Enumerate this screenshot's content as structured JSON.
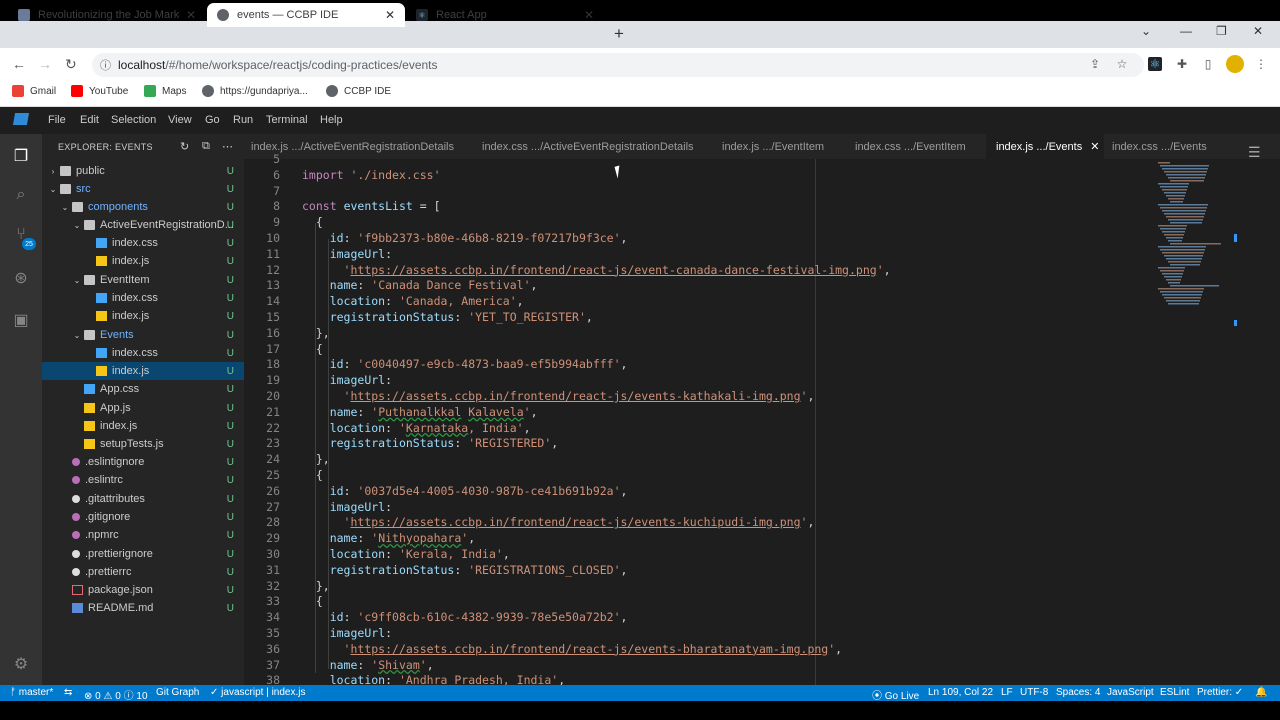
{
  "browser": {
    "tabs": [
      {
        "title": "Revolutionizing the Job Market |"
      },
      {
        "title": "events — CCBP IDE"
      },
      {
        "title": "React App"
      }
    ],
    "url_host": "localhost",
    "url_path": "/#/home/workspace/reactjs/coding-practices/events",
    "bookmarks": [
      "Gmail",
      "YouTube",
      "Maps",
      "https://gundapriya...",
      "CCBP IDE"
    ]
  },
  "menu": [
    "File",
    "Edit",
    "Selection",
    "View",
    "Go",
    "Run",
    "Terminal",
    "Help"
  ],
  "explorer": {
    "title": "EXPLORER: EVENTS",
    "items": [
      {
        "label": "public",
        "status": "U"
      },
      {
        "label": "src",
        "status": "U"
      },
      {
        "label": "components",
        "status": "U"
      },
      {
        "label": "ActiveEventRegistrationD...",
        "status": "U"
      },
      {
        "label": "index.css",
        "status": "U"
      },
      {
        "label": "index.js",
        "status": "U"
      },
      {
        "label": "EventItem",
        "status": "U"
      },
      {
        "label": "index.css",
        "status": "U"
      },
      {
        "label": "index.js",
        "status": "U"
      },
      {
        "label": "Events",
        "status": "U"
      },
      {
        "label": "index.css",
        "status": "U"
      },
      {
        "label": "index.js",
        "status": "U"
      },
      {
        "label": "App.css",
        "status": "U"
      },
      {
        "label": "App.js",
        "status": "U"
      },
      {
        "label": "index.js",
        "status": "U"
      },
      {
        "label": "setupTests.js",
        "status": "U"
      },
      {
        "label": ".eslintignore",
        "status": "U"
      },
      {
        "label": ".eslintrc",
        "status": "U"
      },
      {
        "label": ".gitattributes",
        "status": "U"
      },
      {
        "label": ".gitignore",
        "status": "U"
      },
      {
        "label": ".npmrc",
        "status": "U"
      },
      {
        "label": ".prettierignore",
        "status": "U"
      },
      {
        "label": ".prettierrc",
        "status": "U"
      },
      {
        "label": "package.json",
        "status": "U"
      },
      {
        "label": "README.md",
        "status": "U"
      }
    ]
  },
  "editor_tabs": [
    "index.js .../ActiveEventRegistrationDetails",
    "index.css .../ActiveEventRegistrationDetails",
    "index.js .../EventItem",
    "index.css .../EventItem",
    "index.js .../Events",
    "index.css .../Events"
  ],
  "activity_badge": "25",
  "status": {
    "branch": "master*",
    "problems": "0",
    "warnings": "0",
    "info": "10",
    "git_graph": "Git Graph",
    "lang_check": "javascript | index.js",
    "go_live": "Go Live",
    "position": "Ln 109, Col 22",
    "eol": "LF",
    "encoding": "UTF-8",
    "spaces": "Spaces: 4",
    "language": "JavaScript",
    "eslint": "ESLint",
    "prettier": "Prettier: ✓"
  },
  "code": {
    "lines": [
      {
        "n": "5",
        "text": ""
      },
      {
        "n": "6",
        "text": "import './index.css'"
      },
      {
        "n": "7",
        "text": ""
      },
      {
        "n": "8",
        "text": "const eventsList = ["
      },
      {
        "n": "9",
        "text": "  {"
      },
      {
        "n": "10",
        "text": "    id: 'f9bb2373-b80e-46b8-8219-f07217b9f3ce',"
      },
      {
        "n": "11",
        "text": "    imageUrl:"
      },
      {
        "n": "12",
        "text": "      'https://assets.ccbp.in/frontend/react-js/event-canada-dance-festival-img.png',"
      },
      {
        "n": "13",
        "text": "    name: 'Canada Dance Festival',"
      },
      {
        "n": "14",
        "text": "    location: 'Canada, America',"
      },
      {
        "n": "15",
        "text": "    registrationStatus: 'YET_TO_REGISTER',"
      },
      {
        "n": "16",
        "text": "  },"
      },
      {
        "n": "17",
        "text": "  {"
      },
      {
        "n": "18",
        "text": "    id: 'c0040497-e9cb-4873-baa9-ef5b994abfff',"
      },
      {
        "n": "19",
        "text": "    imageUrl:"
      },
      {
        "n": "20",
        "text": "      'https://assets.ccbp.in/frontend/react-js/events-kathakali-img.png',"
      },
      {
        "n": "21",
        "text": "    name: 'Puthanalkkal Kalavela',"
      },
      {
        "n": "22",
        "text": "    location: 'Karnataka, India',"
      },
      {
        "n": "23",
        "text": "    registrationStatus: 'REGISTERED',"
      },
      {
        "n": "24",
        "text": "  },"
      },
      {
        "n": "25",
        "text": "  {"
      },
      {
        "n": "26",
        "text": "    id: '0037d5e4-4005-4030-987b-ce41b691b92a',"
      },
      {
        "n": "27",
        "text": "    imageUrl:"
      },
      {
        "n": "28",
        "text": "      'https://assets.ccbp.in/frontend/react-js/events-kuchipudi-img.png',"
      },
      {
        "n": "29",
        "text": "    name: 'Nithyopahara',"
      },
      {
        "n": "30",
        "text": "    location: 'Kerala, India',"
      },
      {
        "n": "31",
        "text": "    registrationStatus: 'REGISTRATIONS_CLOSED',"
      },
      {
        "n": "32",
        "text": "  },"
      },
      {
        "n": "33",
        "text": "  {"
      },
      {
        "n": "34",
        "text": "    id: 'c9ff08cb-610c-4382-9939-78e5e50a72b2',"
      },
      {
        "n": "35",
        "text": "    imageUrl:"
      },
      {
        "n": "36",
        "text": "      'https://assets.ccbp.in/frontend/react-js/events-bharatanatyam-img.png',"
      },
      {
        "n": "37",
        "text": "    name: 'Shivam',"
      },
      {
        "n": "38",
        "text": "    location: 'Andhra Pradesh, India',"
      }
    ]
  }
}
